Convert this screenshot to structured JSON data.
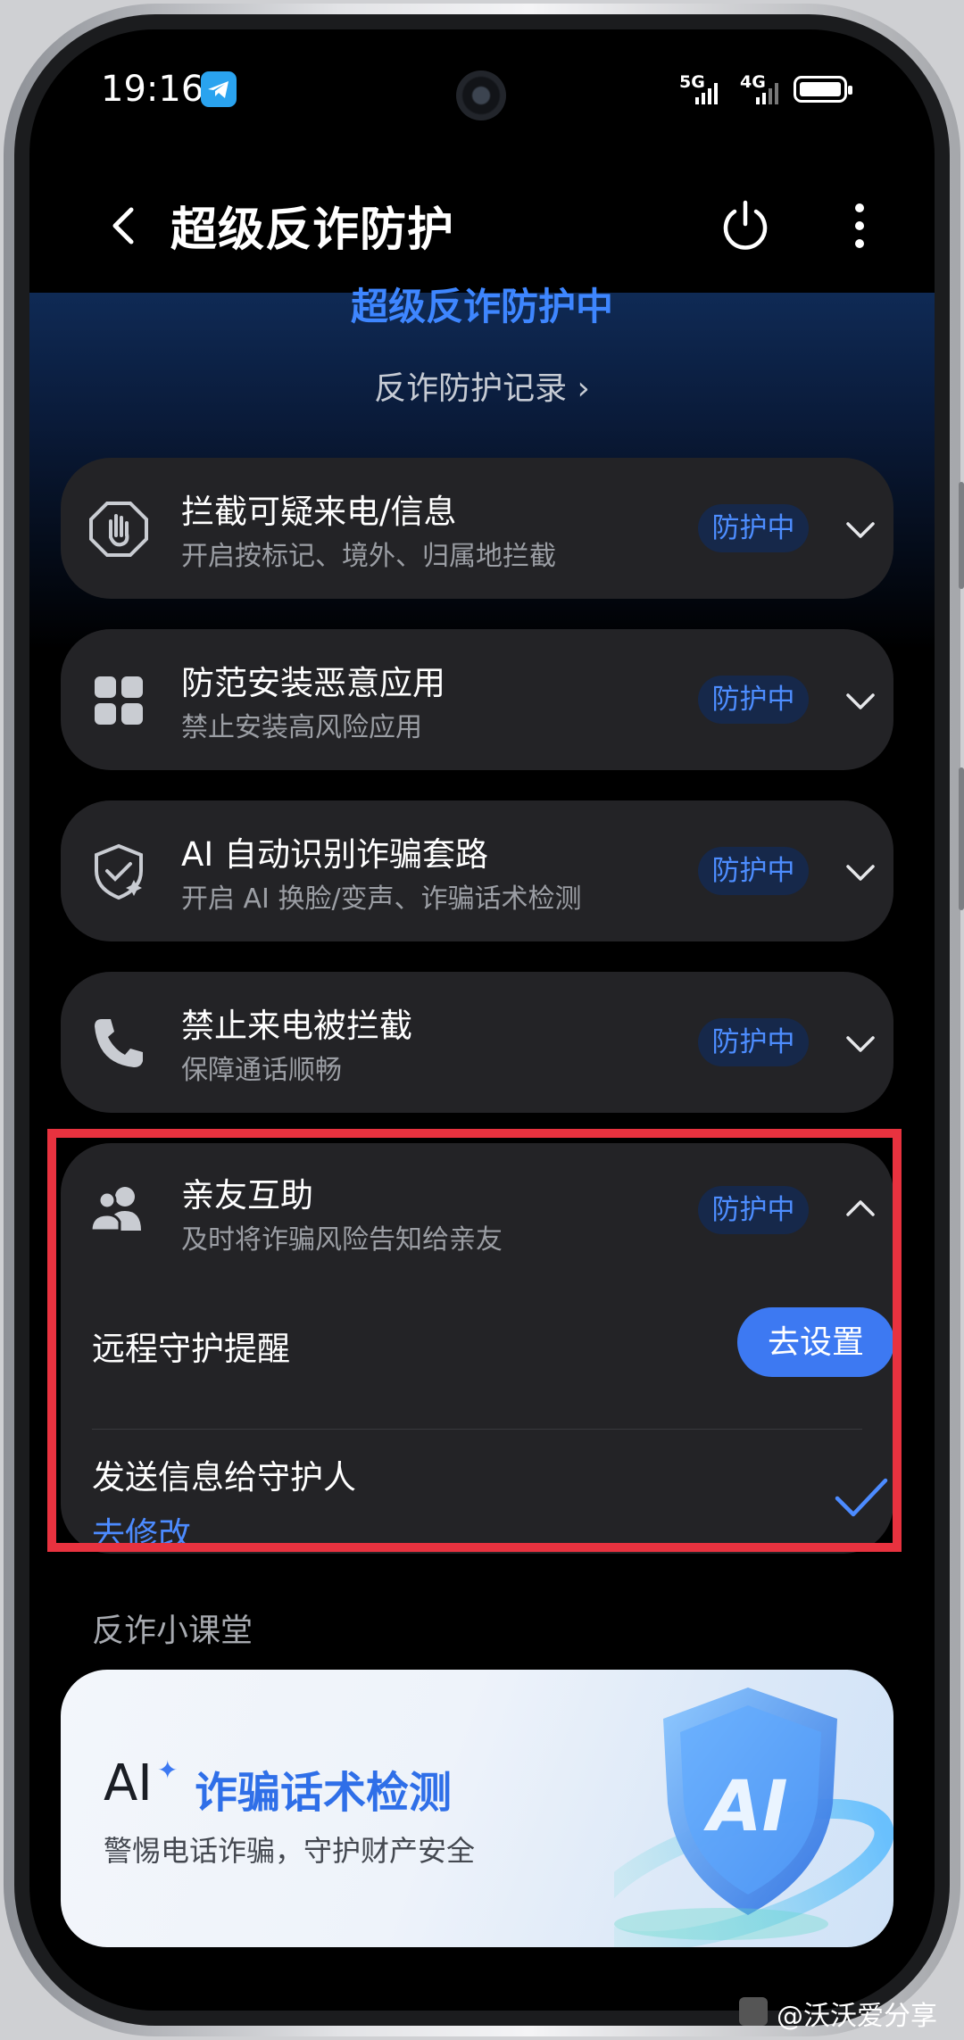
{
  "status_bar": {
    "time": "19:16",
    "network1": "5G",
    "network2": "4G"
  },
  "app_bar": {
    "title": "超级反诈防护"
  },
  "hero": {
    "status": "超级反诈防护中",
    "record_link": "反诈防护记录 ›"
  },
  "cards": [
    {
      "title": "拦截可疑来电/信息",
      "subtitle": "开启按标记、境外、归属地拦截",
      "badge": "防护中",
      "icon": "hand-stop-icon"
    },
    {
      "title": "防范安装恶意应用",
      "subtitle": "禁止安装高风险应用",
      "badge": "防护中",
      "icon": "apps-grid-icon"
    },
    {
      "title": "AI 自动识别诈骗套路",
      "subtitle": "开启 AI 换脸/变声、诈骗话术检测",
      "badge": "防护中",
      "icon": "shield-ai-icon"
    },
    {
      "title": "禁止来电被拦截",
      "subtitle": "保障通话顺畅",
      "badge": "防护中",
      "icon": "phone-icon"
    }
  ],
  "family_card": {
    "title": "亲友互助",
    "subtitle": "及时将诈骗风险告知给亲友",
    "badge": "防护中",
    "remote_label": "远程守护提醒",
    "setup_button": "去设置",
    "send_label": "发送信息给守护人",
    "modify_link": "去修改"
  },
  "section": {
    "title": "反诈小课堂"
  },
  "banner": {
    "ai": "AI",
    "spark": "✦",
    "title": "诈骗话术检测",
    "subtitle": "警惕电话诈骗，守护财产安全",
    "shield_text": "AI"
  },
  "watermark": {
    "text": "@沃沃爱分享"
  },
  "colors": {
    "accent": "#3d79f2",
    "badge_bg": "#16284a",
    "card_bg": "#232326",
    "highlight": "#e8323f"
  }
}
